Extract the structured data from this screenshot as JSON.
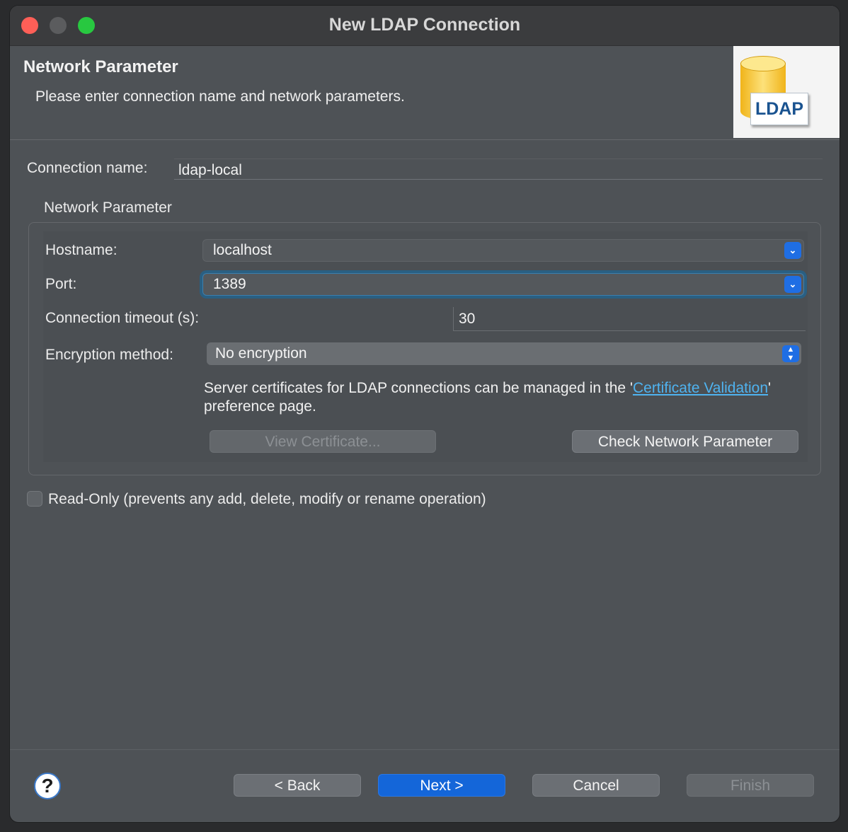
{
  "window": {
    "title": "New LDAP Connection"
  },
  "banner": {
    "title": "Network Parameter",
    "description": "Please enter connection name and network parameters.",
    "logo_text": "LDAP"
  },
  "connection": {
    "label": "Connection name:",
    "value": "ldap-local"
  },
  "network": {
    "group_title": "Network Parameter",
    "hostname": {
      "label": "Hostname:",
      "value": "localhost"
    },
    "port": {
      "label": "Port:",
      "value": "1389"
    },
    "timeout": {
      "label": "Connection timeout (s):",
      "value": "30"
    },
    "encryption": {
      "label": "Encryption method:",
      "value": "No encryption"
    },
    "cert_note": {
      "prefix": "Server certificates for LDAP connections can be managed in the '",
      "link": "Certificate Validation",
      "suffix": "' preference page."
    },
    "view_certificate_label": "View Certificate...",
    "check_label": "Check Network Parameter"
  },
  "readonly": {
    "label": "Read-Only (prevents any add, delete, modify or rename operation)",
    "checked": false
  },
  "footer": {
    "help_icon": "?",
    "back_label": "< Back",
    "next_label": "Next >",
    "cancel_label": "Cancel",
    "finish_label": "Finish"
  }
}
